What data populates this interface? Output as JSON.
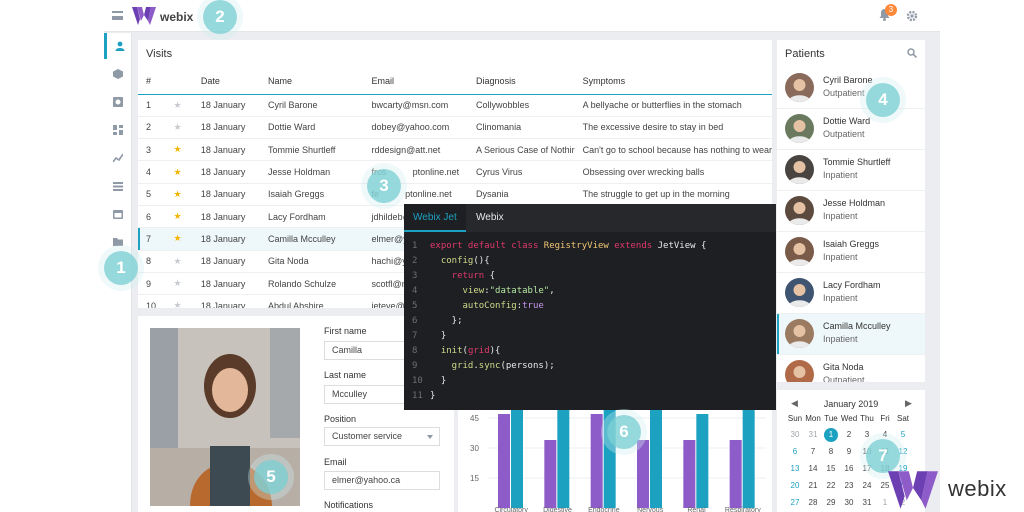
{
  "header": {
    "logo_text": "webix",
    "notification_count": "3"
  },
  "colors": {
    "accent": "#1ca1c1",
    "bar_purple": "#8e5cc9",
    "bar_teal": "#1ca1c1",
    "badge": "#ff8839"
  },
  "sidebar": {
    "icons": [
      "user-icon",
      "cube-icon",
      "history-icon",
      "dashboard-icon",
      "chart-icon",
      "table-icon",
      "calendar-icon",
      "folder-icon"
    ]
  },
  "visits": {
    "title": "Visits",
    "columns": [
      "#",
      "",
      "Date",
      "Name",
      "Email",
      "Diagnosis",
      "Symptoms"
    ],
    "rows": [
      [
        "1",
        "off",
        "18 January",
        "Cyril Barone",
        "bwcarty@msn.com",
        "Collywobbles",
        "A bellyache or butterflies in the stomach"
      ],
      [
        "2",
        "off",
        "18 January",
        "Dottie Ward",
        "dobey@yahoo.com",
        "Clinomania",
        "The excessive desire to stay in bed"
      ],
      [
        "3",
        "on",
        "18 January",
        "Tommie Shurtleff",
        "rddesign@att.net",
        "A Serious Case of Nothir",
        "Can't go to school because has nothing to wear"
      ],
      [
        "4",
        "on",
        "18 January",
        "Jesse Holdman",
        "fros",
        "Cyrus Virus",
        "Obsessing over wrecking balls"
      ],
      [
        "5",
        "on",
        "18 January",
        "Isaiah Greggs",
        "fe",
        "Dysania",
        "The struggle to get up in the morning"
      ],
      [
        "6",
        "on",
        "18 January",
        "Lacy Fordham",
        "jdhildeb@",
        "",
        ""
      ],
      [
        "7",
        "on",
        "18 January",
        "Camilla Mcculley",
        "elmer@yaho",
        "",
        ""
      ],
      [
        "8",
        "off",
        "18 January",
        "Gita Noda",
        "hachi@yaho",
        "",
        ""
      ],
      [
        "9",
        "off",
        "18 January",
        "Rolando Schulze",
        "scotfl@me.c",
        "",
        ""
      ],
      [
        "10",
        "off",
        "18 January",
        "Abdul Abshire",
        "jeteye@aol",
        "",
        ""
      ]
    ]
  },
  "visits_email_tails": {
    "row4": "ptonline.net",
    "row5": "ptonline.net"
  },
  "form": {
    "first_name_label": "First name",
    "first_name_value": "Camilla",
    "last_name_label": "Last name",
    "last_name_value": "Mcculley",
    "position_label": "Position",
    "position_value": "Customer service",
    "email_label": "Email",
    "email_value": "elmer@yahoo.ca",
    "notifications_label": "Notifications"
  },
  "patients": {
    "title": "Patients",
    "items": [
      {
        "name": "Cyril Barone",
        "status": "Outpatient",
        "color": "#8a6a5a"
      },
      {
        "name": "Dottie Ward",
        "status": "Outpatient",
        "color": "#6b7a5e"
      },
      {
        "name": "Tommie Shurtleff",
        "status": "Inpatient",
        "color": "#4a4440"
      },
      {
        "name": "Jesse Holdman",
        "status": "Inpatient",
        "color": "#5d4a3e"
      },
      {
        "name": "Isaiah Greggs",
        "status": "Inpatient",
        "color": "#7a5a48"
      },
      {
        "name": "Lacy Fordham",
        "status": "Inpatient",
        "color": "#3f5470"
      },
      {
        "name": "Camilla Mcculley",
        "status": "Inpatient",
        "color": "#9a7a60"
      },
      {
        "name": "Gita Noda",
        "status": "Outpatient",
        "color": "#b06a48"
      }
    ]
  },
  "calendar": {
    "title": "January 2019",
    "weekdays": [
      "Sun",
      "Mon",
      "Tue",
      "Wed",
      "Thu",
      "Fri",
      "Sat"
    ],
    "days": [
      [
        "30",
        "31",
        "1",
        "2",
        "3",
        "4",
        "5"
      ],
      [
        "6",
        "7",
        "8",
        "9",
        "10",
        "11",
        "12"
      ],
      [
        "13",
        "14",
        "15",
        "16",
        "17",
        "18",
        "19"
      ],
      [
        "20",
        "21",
        "22",
        "23",
        "24",
        "25",
        "26"
      ],
      [
        "27",
        "28",
        "29",
        "30",
        "31",
        "1",
        "2"
      ]
    ],
    "selected": "1"
  },
  "code": {
    "tabs": [
      "Webix Jet",
      "Webix"
    ],
    "line_numbers": [
      "1",
      "2",
      "3",
      "4",
      "5",
      "6",
      "7",
      "8",
      "9",
      "10",
      "11"
    ]
  },
  "chart_data": {
    "type": "bar",
    "title": "",
    "categories": [
      "Circulatory",
      "Digestive",
      "Endocrine",
      "Nervous",
      "Renal",
      "Respiratory"
    ],
    "series": [
      {
        "values": [
          47,
          34,
          47,
          34,
          34,
          34
        ]
      },
      {
        "values": [
          54,
          61,
          50,
          54,
          47,
          54
        ]
      }
    ],
    "y_ticks": [
      "45",
      "30",
      "15"
    ],
    "ylim": [
      0,
      60
    ]
  },
  "markers": [
    "1",
    "2",
    "3",
    "4",
    "5",
    "6",
    "7"
  ],
  "brand": {
    "text": "webix"
  }
}
